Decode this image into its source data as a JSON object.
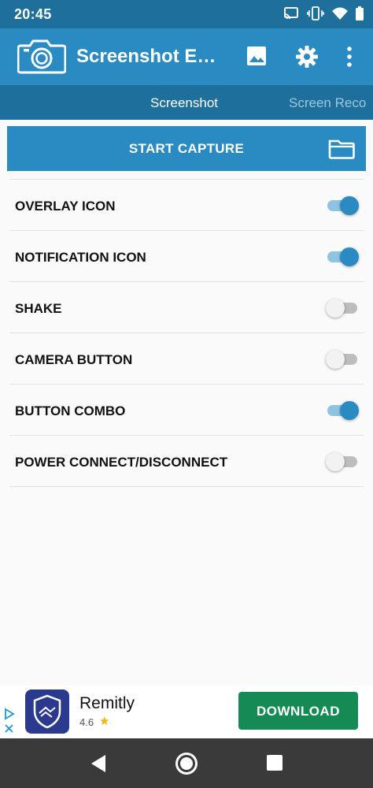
{
  "status_bar": {
    "time": "20:45",
    "icons": [
      "cast-icon",
      "vibrate-icon",
      "wifi-icon",
      "battery-icon"
    ]
  },
  "app_bar": {
    "title": "Screenshot E…",
    "actions": [
      "gallery-icon",
      "settings-gear-icon",
      "overflow-menu-icon"
    ],
    "color": "#2a8bc3"
  },
  "tabs": [
    {
      "label": "Screenshot",
      "active": true
    },
    {
      "label": "Screen Reco",
      "active": false
    }
  ],
  "capture": {
    "label": "START CAPTURE",
    "icon": "folder-icon"
  },
  "settings": [
    {
      "label": "OVERLAY ICON",
      "enabled": true
    },
    {
      "label": "NOTIFICATION ICON",
      "enabled": true
    },
    {
      "label": "SHAKE",
      "enabled": false
    },
    {
      "label": "CAMERA BUTTON",
      "enabled": false
    },
    {
      "label": "BUTTON COMBO",
      "enabled": true
    },
    {
      "label": "POWER CONNECT/DISCONNECT",
      "enabled": false
    }
  ],
  "ad": {
    "app_name": "Remitly",
    "rating": "4.6",
    "star": "★",
    "cta": "DOWNLOAD",
    "cta_color": "#158a54"
  },
  "nav": [
    "back-icon",
    "home-icon",
    "recents-icon"
  ]
}
